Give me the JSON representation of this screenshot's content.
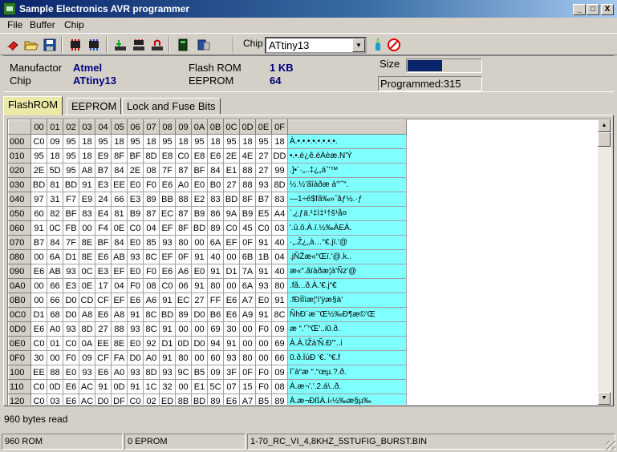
{
  "window": {
    "title": "Sample Electronics AVR programmer",
    "minimize": "_",
    "maximize": "□",
    "close": "X"
  },
  "menu": [
    "File",
    "Buffer",
    "Chip"
  ],
  "toolbar": {
    "chip_label": "Chip",
    "chip_value": "ATtiny13",
    "icons": [
      "erase-icon",
      "open-icon",
      "save-icon",
      "read-chip-icon",
      "write-chip-icon",
      "verify-icon",
      "program-icon",
      "lock-icon",
      "device-icon",
      "config-icon",
      "refresh-icon",
      "stop-icon"
    ]
  },
  "info": {
    "manufacturer_label": "Manufactor",
    "manufacturer": "Atmel",
    "chip_label": "Chip",
    "chip": "ATtiny13",
    "flash_label": "Flash ROM",
    "flash": "1 KB",
    "eeprom_label": "EEPROM",
    "eeprom": "64",
    "size_label": "Size",
    "size_fraction": 0.47,
    "programmed": "Programmed:315"
  },
  "tabs": [
    "FlashROM",
    "EEPROM",
    "Lock and Fuse Bits"
  ],
  "hex": {
    "columns": [
      "00",
      "01",
      "02",
      "03",
      "04",
      "05",
      "06",
      "07",
      "08",
      "09",
      "0A",
      "0B",
      "0C",
      "0D",
      "0E",
      "0F"
    ],
    "rows": [
      {
        "addr": "000",
        "bytes": [
          "C0",
          "09",
          "95",
          "18",
          "95",
          "18",
          "95",
          "18",
          "95",
          "18",
          "95",
          "18",
          "95",
          "18",
          "95",
          "18"
        ],
        "ascii": "À.•.•.•.•.•.•.•.•."
      },
      {
        "addr": "010",
        "bytes": [
          "95",
          "18",
          "95",
          "18",
          "E9",
          "8F",
          "BF",
          "8D",
          "E8",
          "C0",
          "E8",
          "E6",
          "2E",
          "4E",
          "27",
          "DD"
        ],
        "ascii": "•.•.é¿ê.èÀèæ.N'Ý"
      },
      {
        "addr": "020",
        "bytes": [
          "2E",
          "5D",
          "95",
          "A8",
          "B7",
          "84",
          "2E",
          "08",
          "7F",
          "87",
          "BF",
          "84",
          "E1",
          "88",
          "27",
          "99"
        ],
        "ascii": ".]•¨·„..‡¿„áˆ'™"
      },
      {
        "addr": "030",
        "bytes": [
          "BD",
          "81",
          "BD",
          "91",
          "E3",
          "EE",
          "E0",
          "F0",
          "E6",
          "A0",
          "E0",
          "B0",
          "27",
          "88",
          "93",
          "8D"
        ],
        "ascii": "½.½'ãîàðæ à°'ˆ“."
      },
      {
        "addr": "040",
        "bytes": [
          "97",
          "31",
          "F7",
          "E9",
          "24",
          "66",
          "E3",
          "89",
          "BB",
          "88",
          "E2",
          "83",
          "BD",
          "8F",
          "B7",
          "83"
        ],
        "ascii": "—1÷é$fã‰»ˆâƒ½.·ƒ"
      },
      {
        "addr": "050",
        "bytes": [
          "60",
          "82",
          "BF",
          "83",
          "E4",
          "81",
          "B9",
          "87",
          "EC",
          "87",
          "B9",
          "86",
          "9A",
          "B9",
          "E5",
          "A4"
        ],
        "ascii": "`‚¿ƒä.¹‡ì‡¹†š¹å¤"
      },
      {
        "addr": "060",
        "bytes": [
          "91",
          "0C",
          "FB",
          "00",
          "F4",
          "0E",
          "C0",
          "04",
          "EF",
          "8F",
          "BD",
          "89",
          "C0",
          "45",
          "C0",
          "03"
        ],
        "ascii": "'.û.ô.À.ï.½‰ÀEÀ."
      },
      {
        "addr": "070",
        "bytes": [
          "B7",
          "84",
          "7F",
          "8E",
          "BF",
          "84",
          "E0",
          "85",
          "93",
          "80",
          "00",
          "6A",
          "EF",
          "0F",
          "91",
          "40"
        ],
        "ascii": "·„.Ž¿„à…“€.jï.'@"
      },
      {
        "addr": "080",
        "bytes": [
          "00",
          "6A",
          "D1",
          "8E",
          "E6",
          "AB",
          "93",
          "8C",
          "EF",
          "0F",
          "91",
          "40",
          "00",
          "6B",
          "1B",
          "04"
        ],
        "ascii": ".jÑŽæ«“Œï.'@.k.."
      },
      {
        "addr": "090",
        "bytes": [
          "E6",
          "AB",
          "93",
          "0C",
          "E3",
          "EF",
          "E0",
          "F0",
          "E6",
          "A6",
          "E0",
          "91",
          "D1",
          "7A",
          "91",
          "40"
        ],
        "ascii": "æ«“.ãïàðæ¦à'Ñz'@"
      },
      {
        "addr": "0A0",
        "bytes": [
          "00",
          "66",
          "E3",
          "0E",
          "17",
          "04",
          "F0",
          "08",
          "C0",
          "06",
          "91",
          "80",
          "00",
          "6A",
          "93",
          "80"
        ],
        "ascii": ".fã...ð.À.'€.j“€"
      },
      {
        "addr": "0B0",
        "bytes": [
          "00",
          "66",
          "D0",
          "CD",
          "CF",
          "EF",
          "E6",
          "A6",
          "91",
          "EC",
          "27",
          "FF",
          "E6",
          "A7",
          "E0",
          "91"
        ],
        "ascii": ".fÐÍÏïæ¦'ì'ÿæ§à'"
      },
      {
        "addr": "0C0",
        "bytes": [
          "D1",
          "68",
          "D0",
          "A8",
          "E6",
          "A8",
          "91",
          "8C",
          "BD",
          "89",
          "D0",
          "B6",
          "E6",
          "A9",
          "91",
          "8C"
        ],
        "ascii": "ÑhÐ¨æ¨'Œ½‰Ð¶æ©'Œ"
      },
      {
        "addr": "0D0",
        "bytes": [
          "E6",
          "A0",
          "93",
          "8D",
          "27",
          "88",
          "93",
          "8C",
          "91",
          "00",
          "00",
          "69",
          "30",
          "00",
          "F0",
          "09"
        ],
        "ascii": "æ “.'ˆ“Œ'..i0.ð."
      },
      {
        "addr": "0E0",
        "bytes": [
          "C0",
          "01",
          "C0",
          "0A",
          "EE",
          "8E",
          "E0",
          "92",
          "D1",
          "0D",
          "D0",
          "94",
          "91",
          "00",
          "00",
          "69"
        ],
        "ascii": "À.À.îŽà'Ñ.Ð”'..i"
      },
      {
        "addr": "0F0",
        "bytes": [
          "30",
          "00",
          "F0",
          "09",
          "CF",
          "FA",
          "D0",
          "A0",
          "91",
          "80",
          "00",
          "60",
          "93",
          "80",
          "00",
          "66"
        ],
        "ascii": "0.ð.ÏúÐ '€.`“€.f"
      },
      {
        "addr": "100",
        "bytes": [
          "EE",
          "88",
          "E0",
          "93",
          "E6",
          "A0",
          "93",
          "8D",
          "93",
          "9C",
          "B5",
          "09",
          "3F",
          "0F",
          "F0",
          "09"
        ],
        "ascii": "îˆà“æ “.“œµ.?.ð."
      },
      {
        "addr": "110",
        "bytes": [
          "C0",
          "0D",
          "E6",
          "AC",
          "91",
          "0D",
          "91",
          "1C",
          "32",
          "00",
          "E1",
          "5C",
          "07",
          "15",
          "F0",
          "08"
        ],
        "ascii": "À.æ¬'.'.2.á\\..ð."
      },
      {
        "addr": "120",
        "bytes": [
          "C0",
          "03",
          "E6",
          "AC",
          "D0",
          "DF",
          "C0",
          "02",
          "ED",
          "8B",
          "BD",
          "89",
          "E6",
          "A7",
          "B5",
          "89"
        ],
        "ascii": "À.æ¬ÐßÀ.í‹½‰æ§µ‰"
      }
    ]
  },
  "message": "960 bytes read",
  "status": [
    "960 ROM",
    "0 EPROM",
    "1-70_RC_VI_4,8KHZ_5STUFIG_BURST.BIN"
  ]
}
